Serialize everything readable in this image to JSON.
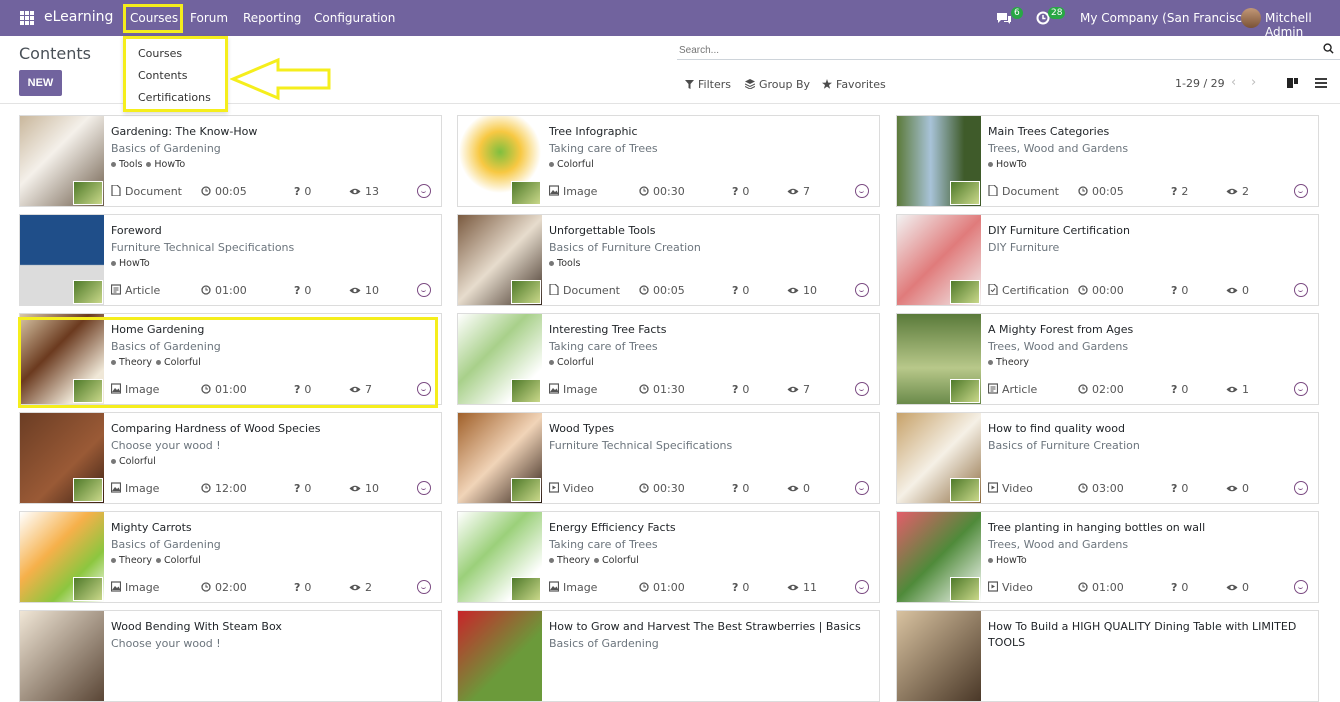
{
  "navbar": {
    "app_name": "eLearning",
    "menu": [
      "Courses",
      "Forum",
      "Reporting",
      "Configuration"
    ],
    "messages_count": "6",
    "activities_count": "28",
    "company": "My Company (San Francisco)",
    "user": "Mitchell Admin"
  },
  "courses_dropdown": [
    "Courses",
    "Contents",
    "Certifications"
  ],
  "control": {
    "title": "Contents",
    "new_label": "NEW",
    "search_placeholder": "Search...",
    "filters": "Filters",
    "group_by": "Group By",
    "favorites": "Favorites",
    "pager": "1-29 / 29"
  },
  "colors": {
    "brand": "#71639e",
    "highlight": "#f5ee1c",
    "badge": "#28a745"
  },
  "cards": [
    {
      "title": "Gardening: The Know-How",
      "course": "Basics of Gardening",
      "tags": [
        "Tools",
        "HowTo"
      ],
      "type": "Document",
      "type_icon": "document-icon",
      "duration": "00:05",
      "questions": "0",
      "views": "13"
    },
    {
      "title": "Tree Infographic",
      "course": "Taking care of Trees",
      "tags": [
        "Colorful"
      ],
      "type": "Image",
      "type_icon": "image-icon",
      "duration": "00:30",
      "questions": "0",
      "views": "7"
    },
    {
      "title": "Main Trees Categories",
      "course": "Trees, Wood and Gardens",
      "tags": [
        "HowTo"
      ],
      "type": "Document",
      "type_icon": "document-icon",
      "duration": "00:05",
      "questions": "2",
      "views": "2"
    },
    {
      "title": "Foreword",
      "course": "Furniture Technical Specifications",
      "tags": [
        "HowTo"
      ],
      "type": "Article",
      "type_icon": "article-icon",
      "duration": "01:00",
      "questions": "0",
      "views": "10"
    },
    {
      "title": "Unforgettable Tools",
      "course": "Basics of Furniture Creation",
      "tags": [
        "Tools"
      ],
      "type": "Document",
      "type_icon": "document-icon",
      "duration": "00:05",
      "questions": "0",
      "views": "10"
    },
    {
      "title": "DIY Furniture Certification",
      "course": "DIY Furniture",
      "tags": [],
      "type": "Certification",
      "type_icon": "certification-icon",
      "duration": "00:00",
      "questions": "0",
      "views": "0"
    },
    {
      "title": "Home Gardening",
      "course": "Basics of Gardening",
      "tags": [
        "Theory",
        "Colorful"
      ],
      "type": "Image",
      "type_icon": "image-icon",
      "duration": "01:00",
      "questions": "0",
      "views": "7"
    },
    {
      "title": "Interesting Tree Facts",
      "course": "Taking care of Trees",
      "tags": [
        "Colorful"
      ],
      "type": "Image",
      "type_icon": "image-icon",
      "duration": "01:30",
      "questions": "0",
      "views": "7"
    },
    {
      "title": "A Mighty Forest from Ages",
      "course": "Trees, Wood and Gardens",
      "tags": [
        "Theory"
      ],
      "type": "Article",
      "type_icon": "article-icon",
      "duration": "02:00",
      "questions": "0",
      "views": "1"
    },
    {
      "title": "Comparing Hardness of Wood Species",
      "course": "Choose your wood !",
      "tags": [
        "Colorful"
      ],
      "type": "Image",
      "type_icon": "image-icon",
      "duration": "12:00",
      "questions": "0",
      "views": "10"
    },
    {
      "title": "Wood Types",
      "course": "Furniture Technical Specifications",
      "tags": [],
      "type": "Video",
      "type_icon": "video-icon",
      "duration": "00:30",
      "questions": "0",
      "views": "0"
    },
    {
      "title": "How to find quality wood",
      "course": "Basics of Furniture Creation",
      "tags": [],
      "type": "Video",
      "type_icon": "video-icon",
      "duration": "03:00",
      "questions": "0",
      "views": "0"
    },
    {
      "title": "Mighty Carrots",
      "course": "Basics of Gardening",
      "tags": [
        "Theory",
        "Colorful"
      ],
      "type": "Image",
      "type_icon": "image-icon",
      "duration": "02:00",
      "questions": "0",
      "views": "2"
    },
    {
      "title": "Energy Efficiency Facts",
      "course": "Taking care of Trees",
      "tags": [
        "Theory",
        "Colorful"
      ],
      "type": "Image",
      "type_icon": "image-icon",
      "duration": "01:00",
      "questions": "0",
      "views": "11"
    },
    {
      "title": "Tree planting in hanging bottles on wall",
      "course": "Trees, Wood and Gardens",
      "tags": [
        "HowTo"
      ],
      "type": "Video",
      "type_icon": "video-icon",
      "duration": "01:00",
      "questions": "0",
      "views": "0"
    },
    {
      "title": "Wood Bending With Steam Box",
      "course": "Choose your wood !",
      "tags": [],
      "type": "",
      "type_icon": "",
      "duration": "",
      "questions": "",
      "views": ""
    },
    {
      "title": "How to Grow and Harvest The Best Strawberries | Basics",
      "course": "Basics of Gardening",
      "tags": [],
      "type": "",
      "type_icon": "",
      "duration": "",
      "questions": "",
      "views": ""
    },
    {
      "title": "How To Build a HIGH QUALITY Dining Table with LIMITED",
      "title2": "TOOLS",
      "course": "",
      "tags": [],
      "type": "",
      "type_icon": "",
      "duration": "",
      "questions": "",
      "views": ""
    }
  ]
}
